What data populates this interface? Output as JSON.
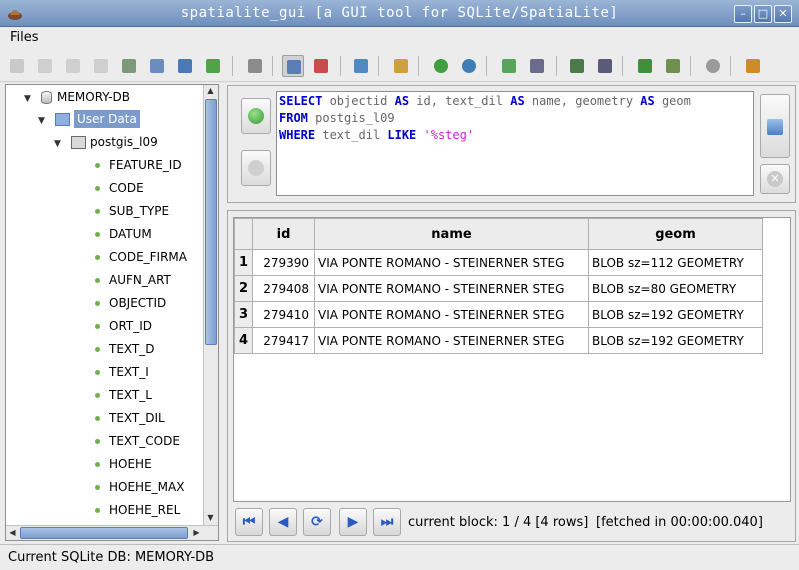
{
  "window": {
    "title": "spatialite_gui      [a GUI tool for SQLite/SpatiaLite]",
    "min_glyph": "–",
    "max_glyph": "□",
    "close_glyph": "✕"
  },
  "menu": {
    "files_label": "Files"
  },
  "tree": {
    "root_label": "MEMORY-DB",
    "folder_label": "User Data",
    "table_label": "postgis_l09",
    "columns": [
      "FEATURE_ID",
      "CODE",
      "SUB_TYPE",
      "DATUM",
      "CODE_FIRMA",
      "AUFN_ART",
      "OBJECTID",
      "ORT_ID",
      "TEXT_D",
      "TEXT_I",
      "TEXT_L",
      "TEXT_DIL",
      "TEXT_CODE",
      "HOEHE",
      "HOEHE_MAX",
      "HOEHE_REL"
    ]
  },
  "sql": {
    "tokens": {
      "select": "SELECT",
      "select_rest": " objectid ",
      "as1": "AS",
      "mid1": " id, text_dil ",
      "as2": "AS",
      "mid2": " name, geometry ",
      "as3": "AS",
      "end1": " geom",
      "from": "FROM",
      "table": " postgis_l09",
      "where": "WHERE",
      "where_col": " text_dil ",
      "like": "LIKE",
      "pattern": " '%steg'"
    }
  },
  "results": {
    "headers": [
      "id",
      "name",
      "geom"
    ],
    "rows": [
      {
        "n": "1",
        "id": "279390",
        "name": "VIA PONTE ROMANO - STEINERNER STEG",
        "geom": "BLOB sz=112 GEOMETRY"
      },
      {
        "n": "2",
        "id": "279408",
        "name": "VIA PONTE ROMANO - STEINERNER STEG",
        "geom": "BLOB sz=80 GEOMETRY"
      },
      {
        "n": "3",
        "id": "279410",
        "name": "VIA PONTE ROMANO - STEINERNER STEG",
        "geom": "BLOB sz=192 GEOMETRY"
      },
      {
        "n": "4",
        "id": "279417",
        "name": "VIA PONTE ROMANO - STEINERNER STEG",
        "geom": "BLOB sz=192 GEOMETRY"
      }
    ],
    "block_info": "current block: 1 / 4 [4 rows]",
    "fetched_info": "[fetched in 00:00:00.040]"
  },
  "status": {
    "text": "Current SQLite DB: MEMORY-DB"
  },
  "colors": {
    "accent": "#7b9cca",
    "keyword": "#0000cc",
    "string": "#cc22cc"
  }
}
